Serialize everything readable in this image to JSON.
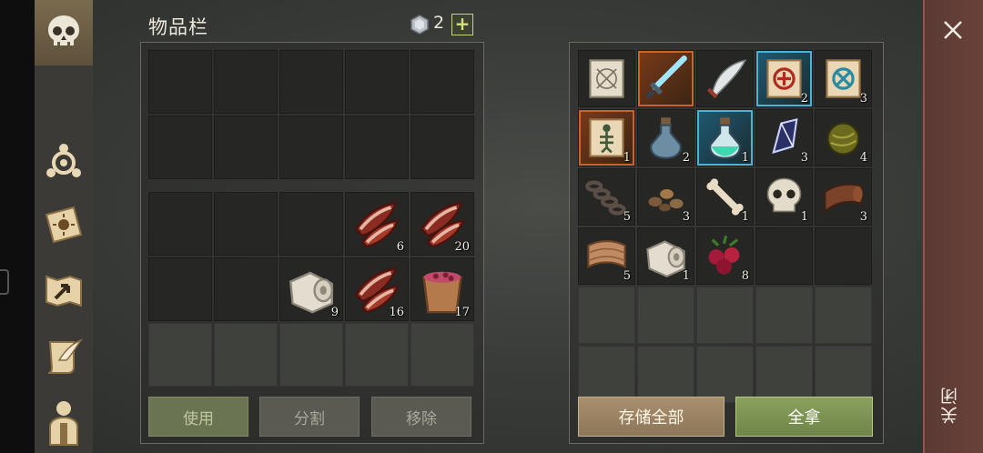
{
  "header": {
    "title": "物品栏",
    "gem_count": "2",
    "add_label": "+"
  },
  "sidebar": {
    "tabs": [
      {
        "name": "tab-skull",
        "icon": "skull-icon"
      },
      {
        "name": "tab-crafting",
        "icon": "crafting-gear-icon"
      },
      {
        "name": "tab-journal",
        "icon": "sun-book-icon"
      },
      {
        "name": "tab-map",
        "icon": "map-arrow-icon"
      },
      {
        "name": "tab-quests",
        "icon": "scroll-feather-icon"
      },
      {
        "name": "tab-character",
        "icon": "character-icon"
      }
    ]
  },
  "left_panel": {
    "equip_slots": 10,
    "backpack": [
      {
        "item": "",
        "qty": ""
      },
      {
        "item": "",
        "qty": ""
      },
      {
        "item": "",
        "qty": ""
      },
      {
        "item": "raw-meat-icon",
        "qty": "6"
      },
      {
        "item": "raw-meat-icon",
        "qty": "20"
      },
      {
        "item": "",
        "qty": ""
      },
      {
        "item": "",
        "qty": ""
      },
      {
        "item": "cloth-bandage-icon",
        "qty": "9"
      },
      {
        "item": "raw-meat-icon",
        "qty": "16"
      },
      {
        "item": "berry-bucket-icon",
        "qty": "17"
      },
      {
        "item": "",
        "qty": ""
      },
      {
        "item": "",
        "qty": ""
      },
      {
        "item": "",
        "qty": ""
      },
      {
        "item": "",
        "qty": ""
      },
      {
        "item": "",
        "qty": ""
      }
    ],
    "buttons": {
      "use": "使用",
      "split": "分割",
      "remove": "移除"
    }
  },
  "right_panel": {
    "items": [
      {
        "item": "map-scroll-icon",
        "qty": "",
        "frame": ""
      },
      {
        "item": "blue-sword-icon",
        "qty": "",
        "frame": "orange"
      },
      {
        "item": "scimitar-icon",
        "qty": "",
        "frame": ""
      },
      {
        "item": "red-rune-scroll-icon",
        "qty": "2",
        "frame": "blue"
      },
      {
        "item": "blue-rune-scroll-icon",
        "qty": "3",
        "frame": ""
      },
      {
        "item": "skeleton-scroll-icon",
        "qty": "1",
        "frame": "orange"
      },
      {
        "item": "potion-flask-icon",
        "qty": "2",
        "frame": ""
      },
      {
        "item": "green-potion-icon",
        "qty": "1",
        "frame": "blue"
      },
      {
        "item": "crystal-shard-icon",
        "qty": "3",
        "frame": ""
      },
      {
        "item": "seaweed-ball-icon",
        "qty": "4",
        "frame": ""
      },
      {
        "item": "chain-icon",
        "qty": "5",
        "frame": ""
      },
      {
        "item": "pebbles-icon",
        "qty": "3",
        "frame": ""
      },
      {
        "item": "bone-icon",
        "qty": "1",
        "frame": ""
      },
      {
        "item": "skull-item-icon",
        "qty": "1",
        "frame": ""
      },
      {
        "item": "leather-icon",
        "qty": "3",
        "frame": ""
      },
      {
        "item": "fabric-icon",
        "qty": "5",
        "frame": ""
      },
      {
        "item": "cloth-bandage-icon",
        "qty": "1",
        "frame": ""
      },
      {
        "item": "red-berries-icon",
        "qty": "8",
        "frame": ""
      }
    ],
    "buttons": {
      "store_all": "存储全部",
      "take_all": "全拿"
    }
  },
  "close": {
    "label": "关闭"
  }
}
